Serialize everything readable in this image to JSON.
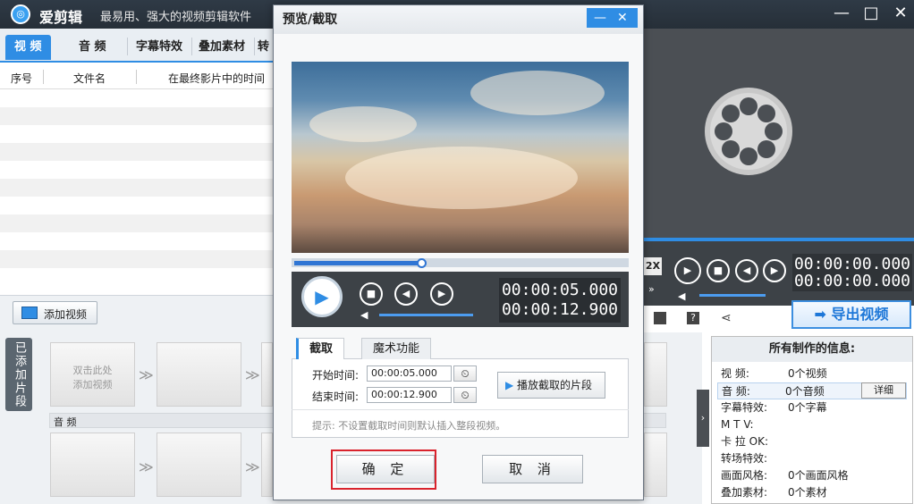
{
  "app": {
    "name": "爱剪辑",
    "slogan": "最易用、强大的视频剪辑软件",
    "minimize": "—",
    "maximize": "□",
    "close": "✕"
  },
  "tabs": [
    "视 频",
    "音 频",
    "字幕特效",
    "叠加素材",
    "转"
  ],
  "file_list": {
    "columns": [
      "序号",
      "文件名",
      "在最终影片中的时间"
    ]
  },
  "add_video_label": "添加视频",
  "added_clips_label": "已添加片段",
  "clip_slot_text": "双击此处\n添加视频",
  "audio_label": "音 频",
  "preview": {
    "time_current": "00:00:00.000",
    "time_total": "00:00:00.000",
    "speed": "2X",
    "export_label": "导出视频"
  },
  "info": {
    "title": "所有制作的信息:",
    "rows": [
      {
        "label": "视    频:",
        "value": "0个视频"
      },
      {
        "label": "音    频:",
        "value": "0个音频"
      },
      {
        "label": "字幕特效:",
        "value": "0个字幕"
      },
      {
        "label": "M  T  V:",
        "value": ""
      },
      {
        "label": "卡 拉 OK:",
        "value": ""
      },
      {
        "label": "转场特效:",
        "value": ""
      },
      {
        "label": "画面风格:",
        "value": "0个画面风格"
      },
      {
        "label": "叠加素材:",
        "value": "0个素材"
      }
    ],
    "detail_label": "详细"
  },
  "dialog": {
    "title": "预览/截取",
    "time_current": "00:00:05.000",
    "time_total": "00:00:12.900",
    "progress": 0.39,
    "subtabs": [
      "截取",
      "魔术功能"
    ],
    "start_label": "开始时间:",
    "start_value": "00:00:05.000",
    "end_label": "结束时间:",
    "end_value": "00:00:12.900",
    "play_clip_label": "播放截取的片段",
    "hint": "提示: 不设置截取时间则默认插入整段视频。",
    "ok_label": "确 定",
    "cancel_label": "取 消"
  },
  "colors": {
    "accent": "#2f8de4",
    "highlight": "#d9232d"
  }
}
